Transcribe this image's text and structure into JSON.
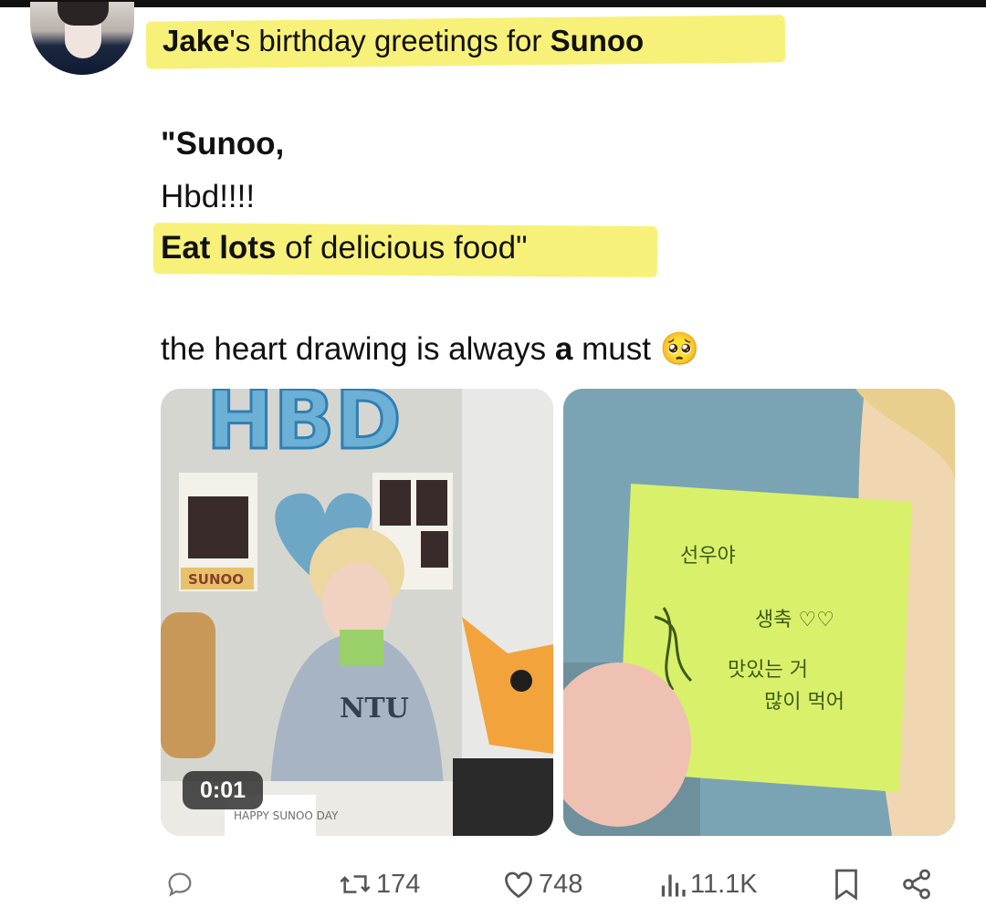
{
  "tweet": {
    "title": {
      "name1": "Jake",
      "mid": "'s birthday greetings for ",
      "name2": "Sunoo"
    },
    "quote": {
      "line1": "\"Sunoo,",
      "line2": "Hbd!!!!",
      "line3_bold": "Eat lots",
      "line3_rest": " of delicious food\""
    },
    "comment": {
      "pre": "the heart drawing is always ",
      "bold": "a",
      "post": " must",
      "emoji": "🥺"
    }
  },
  "media": {
    "video_time": "0:01",
    "balloon_text": "HBD",
    "poster_text": "SUNOO",
    "shirt_text": "NTU",
    "cake_text": "HAPPY SUNOO DAY",
    "note_text": [
      "선우야",
      "생축 ♡♡",
      "맛있는 거",
      "많이 먹어"
    ]
  },
  "actions": {
    "retweets": "174",
    "likes": "748",
    "views": "11.1K"
  },
  "colors": {
    "highlight": "#f7f06a",
    "note": "#d9f06b",
    "icon": "#555555"
  }
}
